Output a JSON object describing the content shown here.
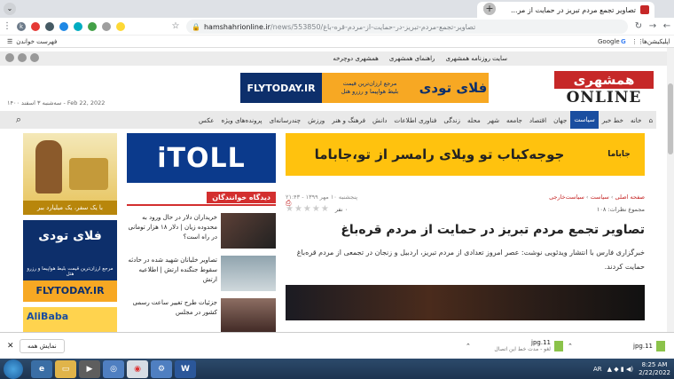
{
  "browser": {
    "tab_title": "تصاویر تجمع مردم تبریز در حمایت از مر...",
    "url_host": "hamshahrionline.ir",
    "url_path": "/news/553850/تصاویر-تجمع-مردم-تبریز-در-حمایت-از-مردم-قره-باغ",
    "profile_initial": "k",
    "bookmarks": {
      "google": "Google",
      "apps": "اپلیکیشن‌ها",
      "reading_list": "فهرست خواندن"
    }
  },
  "site": {
    "top_links": [
      "سایت روزنامه همشهری",
      "راهنمای همشهری",
      "همشهری دوچرخه"
    ],
    "logo_text": "همشهری",
    "logo_sub": "ONLINE",
    "date": "سه‌شنبه ۳ اسفند ۱۴۰۰ - Feb 22, 2022",
    "nav": [
      "خانه",
      "خط خبر",
      "سیاست",
      "جهان",
      "اقتصاد",
      "جامعه",
      "شهر",
      "محله",
      "زندگی",
      "فناوری اطلاعات",
      "دانش",
      "فرهنگ و هنر",
      "ورزش",
      "چندرسانه‌ای",
      "پرونده‌های ویژه",
      "عکس"
    ],
    "nav_active": "سیاست"
  },
  "ads": {
    "flytoday_header": {
      "brand": "فلای تودی",
      "line1": "مرجع ارزان‌ترین قیمت",
      "line2": "بلیط هواپیما و رزرو هتل",
      "url": "FLYTODAY.IR"
    },
    "jabama": {
      "text": "جوجه‌کباب تو ویلای رامسر از تو،جاباما",
      "logo": "جاباما"
    },
    "itoll": "iTOLL",
    "side1_caption": "با یک سفر، یک میلیارد ببر",
    "side2": {
      "brand": "فلای تودی",
      "line": "مرجع ارزان‌ترین قیمت بلیط هواپیما و رزرو هتل",
      "url": "FLYTODAY.IR"
    },
    "side3": "AliBaba"
  },
  "reader": {
    "heading": "دیدگاه خوانندگان",
    "items": [
      {
        "text": "خریداران دلار در حال ورود به محدوده زیان | دلار ۱۸ هزار تومانی در راه است؟"
      },
      {
        "text": "تصاویر خلبانان شهید شده در حادثه سقوط جنگنده ارتش | اطلاعیه ارتش"
      },
      {
        "text": "جزئیات طرح تغییر ساعت رسمی کشور در مجلس"
      }
    ]
  },
  "article": {
    "crumbs": [
      "صفحه اصلی",
      "سیاست",
      "سیاست‌خارجی"
    ],
    "comments": "مجموع نظرات: ۱۰۸",
    "time": "پنجشنبه ۱۰ مهر ۱۳۹۹ - ۲۱:۴۳",
    "rating_count": "۰ نفر",
    "title": "تصاویر تجمع مردم تبریز در حمایت از مردم قره‌باغ",
    "lead": "خبرگزاری فارس با انتشار ویدئویی نوشت: عصر امروز تعدادی از مردم تبریز، اردبیل و زنجان در تجمعی از مردم قره‌باغ حمایت کردند."
  },
  "downloads": {
    "show_all": "نمایش همه",
    "items": [
      {
        "name": "11.jpg",
        "status": "تمام"
      },
      {
        "name": "11.jpg",
        "status": "لغو - مدت خط این اتصال"
      }
    ]
  },
  "taskbar": {
    "lang": "AR",
    "time": "8:25 AM",
    "date": "2/22/2022"
  }
}
